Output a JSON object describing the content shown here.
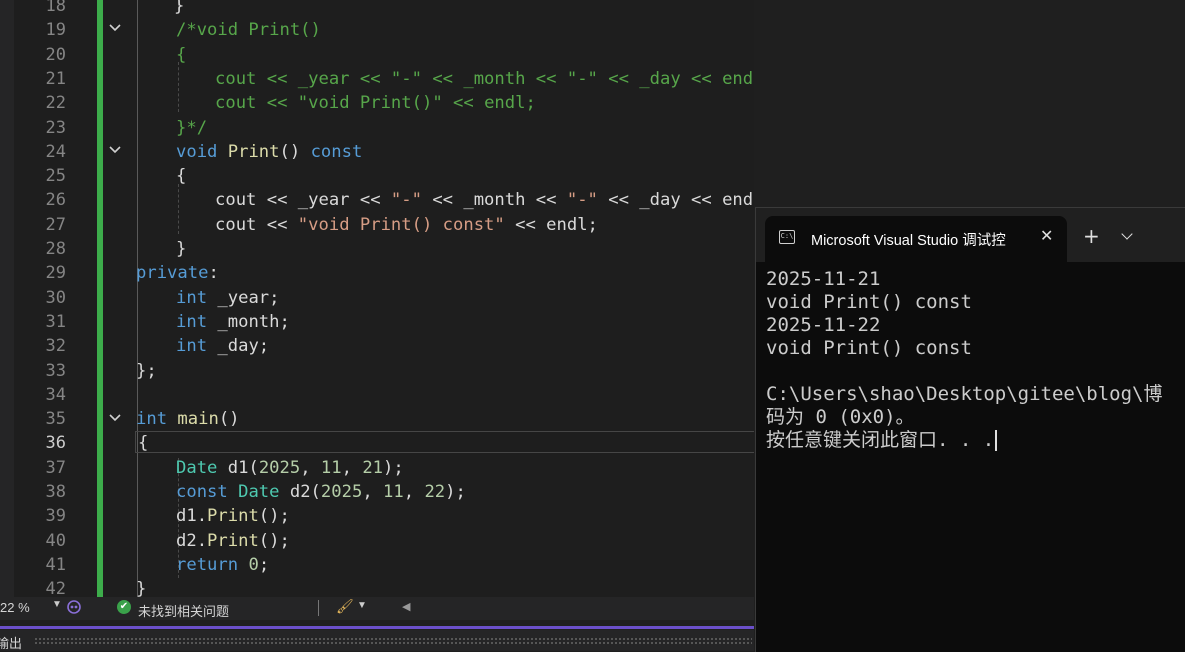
{
  "editor": {
    "line_numbers": [
      "18",
      "19",
      "20",
      "21",
      "22",
      "23",
      "24",
      "25",
      "26",
      "27",
      "28",
      "29",
      "30",
      "31",
      "32",
      "33",
      "34",
      "35",
      "36",
      "37",
      "38",
      "39",
      "40",
      "41",
      "42"
    ],
    "active_line": "36",
    "code": {
      "l18": "}",
      "l19": "/*void Print()",
      "l20": "{",
      "l21_a": "cout << _year << ",
      "l21_s1": "\"-\"",
      "l21_b": " << _month << ",
      "l21_s2": "\"-\"",
      "l21_c": " << _day << endl;",
      "l22_a": "cout << ",
      "l22_s": "\"void Print()\"",
      "l22_b": " << endl;",
      "l23": "}*/",
      "l24_kw": "void",
      "l24_fn": "Print",
      "l24_p": "()",
      "l24_const": "const",
      "l25": "{",
      "l26_a": "cout << _year << ",
      "l26_s1": "\"-\"",
      "l26_b": " << _month << ",
      "l26_s2": "\"-\"",
      "l26_c": " << _day << endl;",
      "l27_a": "cout << ",
      "l27_s": "\"void Print() const\"",
      "l27_b": " << endl;",
      "l28": "}",
      "l29_kw": "private",
      "l29_colon": ":",
      "l30_kw": "int",
      "l30_v": " _year;",
      "l31_kw": "int",
      "l31_v": " _month;",
      "l32_kw": "int",
      "l32_v": " _day;",
      "l33": "};",
      "l35_kw": "int",
      "l35_fn": "main",
      "l35_p": "()",
      "l36": "{",
      "l37_ty": "Date",
      "l37_a": " d1(",
      "l37_n1": "2025",
      "l37_c1": ", ",
      "l37_n2": "11",
      "l37_c2": ", ",
      "l37_n3": "21",
      "l37_e": ");",
      "l38_kw": "const",
      "l38_ty": "Date",
      "l38_a": " d2(",
      "l38_n1": "2025",
      "l38_c1": ", ",
      "l38_n2": "11",
      "l38_c2": ", ",
      "l38_n3": "22",
      "l38_e": ");",
      "l39_a": "d1.",
      "l39_fn": "Print",
      "l39_e": "();",
      "l40_a": "d2.",
      "l40_fn": "Print",
      "l40_e": "();",
      "l41_kw": "return",
      "l41_n": "0",
      "l41_e": ";",
      "l42": "}"
    }
  },
  "statusbar": {
    "zoom": "22 %",
    "issues": "未找到相关问题"
  },
  "output_panel": {
    "label": "输出"
  },
  "terminal": {
    "tab_title": "Microsoft Visual Studio 调试控",
    "lines": [
      "2025-11-21",
      "void Print() const",
      "2025-11-22",
      "void Print() const",
      "",
      "C:\\Users\\shao\\Desktop\\gitee\\blog\\博",
      "码为 0 (0x0)。",
      "按任意键关闭此窗口. . ."
    ]
  },
  "colors": {
    "change_bar": "#3dad4b",
    "keyword": "#569cd6",
    "function": "#dcdcaa",
    "type": "#4ec9b0",
    "comment": "#57a64a",
    "number": "#b5cea8",
    "string": "#d69d85",
    "output_accent": "#6a4fc7"
  }
}
